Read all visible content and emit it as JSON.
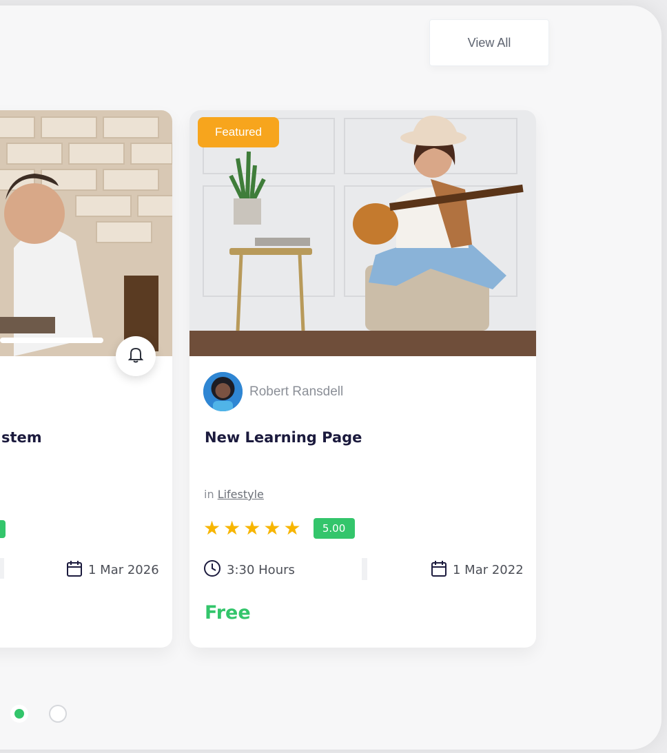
{
  "header": {
    "view_all_label": "View All"
  },
  "colors": {
    "accent_green": "#33c56b",
    "badge_orange": "#f7a51d",
    "star_yellow": "#f7b500",
    "title_navy": "#1b1a3d"
  },
  "cards": [
    {
      "title_visible": "stem",
      "score": "",
      "date": "1 Mar 2026",
      "icons": [
        "bell-icon",
        "calendar-icon"
      ]
    },
    {
      "badge": "Featured",
      "author": "Robert Ransdell",
      "title": "New Learning Page",
      "category_prefix": "in",
      "category": "Lifestyle",
      "rating_stars": 5,
      "score": "5.00",
      "duration": "3:30 Hours",
      "date": "1 Mar 2022",
      "price": "Free",
      "icons": [
        "star-icon",
        "clock-icon",
        "calendar-icon"
      ]
    }
  ],
  "carousel": {
    "active_index": 0,
    "count": 2
  }
}
